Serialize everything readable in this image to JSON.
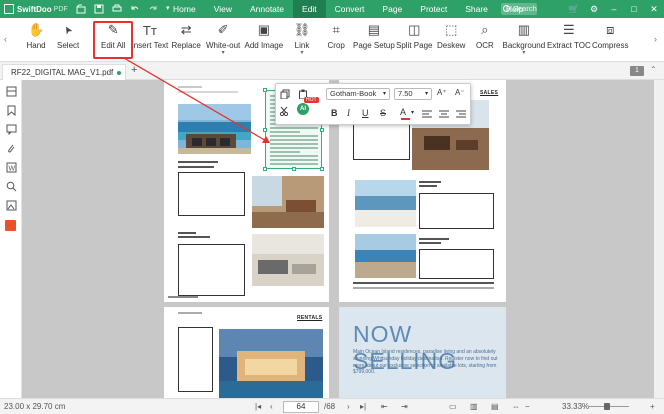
{
  "app": {
    "name": "SwiftDoo",
    "name_suffix": "PDF"
  },
  "menu": [
    "Home",
    "View",
    "Annotate",
    "Edit",
    "Convert",
    "Page",
    "Protect",
    "Share",
    "Help"
  ],
  "active_menu": "Edit",
  "search": {
    "placeholder": "Search"
  },
  "ribbon": {
    "tools": [
      {
        "label": "Hand",
        "icon": "hand-icon"
      },
      {
        "label": "Select",
        "icon": "cursor-icon"
      },
      {
        "label": "Edit All",
        "icon": "edit-all-icon"
      },
      {
        "label": "Insert Text",
        "icon": "insert-text-icon"
      },
      {
        "label": "Replace",
        "icon": "replace-icon"
      },
      {
        "label": "White-out",
        "icon": "white-out-icon"
      },
      {
        "label": "Add Image",
        "icon": "add-image-icon"
      },
      {
        "label": "Link",
        "icon": "link-icon"
      },
      {
        "label": "Crop",
        "icon": "crop-icon"
      },
      {
        "label": "Page Setup",
        "icon": "page-setup-icon"
      },
      {
        "label": "Split Page",
        "icon": "split-page-icon"
      },
      {
        "label": "Deskew",
        "icon": "deskew-icon"
      },
      {
        "label": "OCR",
        "icon": "ocr-icon"
      },
      {
        "label": "Background",
        "icon": "background-icon"
      },
      {
        "label": "Extract TOC",
        "icon": "extract-toc-icon"
      },
      {
        "label": "Compress",
        "icon": "compress-icon"
      }
    ]
  },
  "tab": {
    "filename": "RF22_DIGITAL MAG_V1.pdf",
    "page_badge": "1"
  },
  "format_toolbar": {
    "font": "Gotham-Book",
    "size": "7.50",
    "ai_label": "AI",
    "hot_label": "HOT"
  },
  "document": {
    "sales_header": "SALES",
    "rentals_header": "RENTALS",
    "now_selling": "NOW SELLING",
    "now_selling_lines": [
      "Main Ocean Island residences, paradise living and an absolutely",
      "stunning Whitsunday holiday destination. Register now to find out",
      "more about our exclusive selection of available lots, starting from $799,000."
    ]
  },
  "status": {
    "dimensions": "23.00 x 29.70 cm",
    "current_page": "64",
    "total_pages": "/68",
    "zoom": "33.33%"
  },
  "colors": {
    "brand": "#2ea169",
    "brand_dark": "#1f7f50",
    "highlight": "#e8322e",
    "selection": "#34b07b"
  }
}
